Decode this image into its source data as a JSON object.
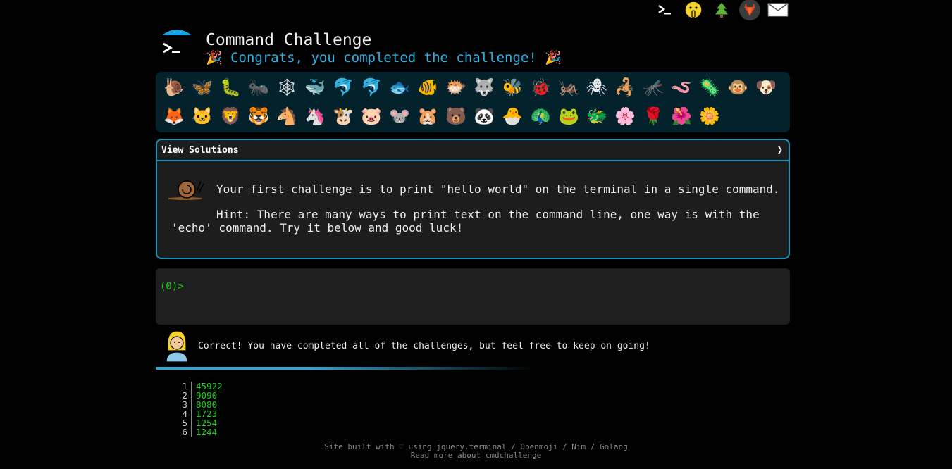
{
  "top_nav": {
    "icons": [
      "terminal-icon",
      "shushing-face-icon",
      "christmas-tree-icon",
      "gitlab-icon",
      "envelope-icon"
    ]
  },
  "header": {
    "title": "Command Challenge",
    "subtitle": "🎉 Congrats, you completed the challenge! 🎉"
  },
  "animals": {
    "row1": [
      "🐌",
      "🦋",
      "🐛",
      "🐜",
      "🕸",
      "🐳",
      "🐬",
      "🐬",
      "🐟",
      "🐠",
      "🐡",
      "🐺",
      "🐝",
      "🐞",
      "🦗",
      "🕷",
      "🦂",
      "🦟",
      "🪱",
      "🦠",
      "🐵",
      "🐶"
    ],
    "row2": [
      "🦊",
      "🐱",
      "🦁",
      "🐯",
      "🐴",
      "🦄",
      "🐮",
      "🐷",
      "🐭",
      "🐹",
      "🐻",
      "🐼",
      "🐣",
      "🦚",
      "🐸",
      "🐲",
      "🌸",
      "🌹",
      "🌺",
      "🌼"
    ]
  },
  "challenge": {
    "solutions_label": "View Solutions",
    "chevron": "❯",
    "text": "Your first challenge is to print \"hello world\" on the terminal in a single command.",
    "hint": "Hint: There are many ways to print text on the command line, one way is with the 'echo' command. Try it below and good luck!"
  },
  "terminal": {
    "prompt": "(0)>"
  },
  "feedback": {
    "text": "Correct! You have completed all of the challenges, but feel free to keep on going!",
    "progress": 1.0
  },
  "stats": [
    {
      "n": "1",
      "v": "45922"
    },
    {
      "n": "2",
      "v": "9090"
    },
    {
      "n": "3",
      "v": "8080"
    },
    {
      "n": "4",
      "v": "1723"
    },
    {
      "n": "5",
      "v": "1254"
    },
    {
      "n": "6",
      "v": "1244"
    }
  ],
  "footer": {
    "line1": "Site built with ♡ using jquery.terminal / Openmoji / Nim / Golang",
    "line2": "Read more about cmdchallenge"
  }
}
